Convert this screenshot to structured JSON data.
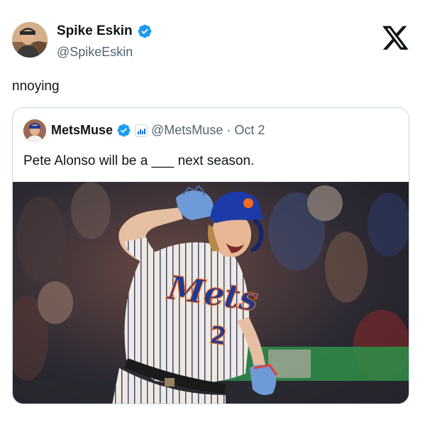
{
  "tweet": {
    "author_name": "Spike Eskin",
    "author_handle": "@SpikeEskin",
    "text": "nnoying"
  },
  "quote": {
    "author_name": "MetsMuse",
    "author_handle": "@MetsMuse",
    "separator": "·",
    "date": "Oct 2",
    "text": "Pete Alonso will be a ___ next season."
  },
  "photo": {
    "jersey_text": "Mets",
    "number": "2"
  },
  "colors": {
    "verified": "#1d9bf0",
    "text_primary": "#0f1419",
    "text_secondary": "#536471",
    "border": "#cfd9de",
    "mets_blue": "#1f3a93",
    "mets_orange": "#f26b21"
  },
  "icons": {
    "verified": "verified-badge-icon",
    "logo": "x-logo-icon",
    "affiliate": "affiliate-badge-icon"
  }
}
